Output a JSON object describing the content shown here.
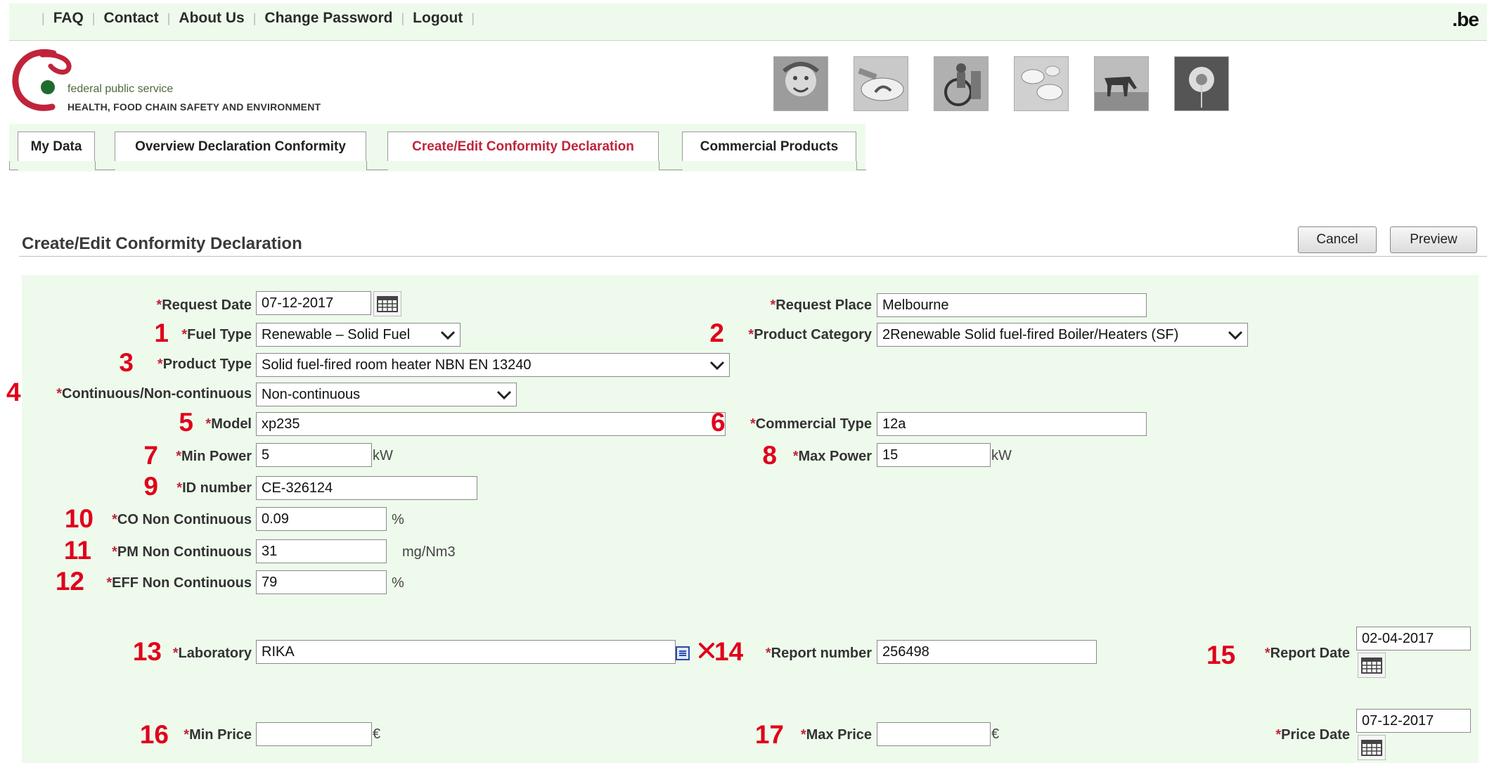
{
  "topnav": {
    "items": [
      "FAQ",
      "Contact",
      "About Us",
      "Change Password",
      "Logout"
    ],
    "brand": ".be"
  },
  "header": {
    "org_small": "federal public service",
    "org_big": "HEALTH, FOOD CHAIN SAFETY AND ENVIRONMENT",
    "photos": [
      "child-photo",
      "food-photo",
      "wheelchair-photo",
      "pills-photo",
      "horse-photo",
      "dandelion-photo"
    ]
  },
  "tabs": [
    {
      "label": "My Data",
      "active": false
    },
    {
      "label": "Overview Declaration Conformity",
      "active": false
    },
    {
      "label": "Create/Edit  Conformity Declaration",
      "active": true
    },
    {
      "label": "Commercial Products",
      "active": false
    }
  ],
  "page": {
    "title": "Create/Edit Conformity Declaration",
    "cancel_label": "Cancel",
    "preview_label": "Preview"
  },
  "form": {
    "request_date": {
      "label": "Request Date",
      "value": "07-12-2017"
    },
    "request_place": {
      "label": "Request Place",
      "value": "Melbourne"
    },
    "fuel_type": {
      "num": "1",
      "label": "Fuel Type",
      "value": "Renewable – Solid Fuel"
    },
    "product_category": {
      "num": "2",
      "label": "Product Category",
      "value": "2Renewable Solid fuel-fired Boiler/Heaters (SF)"
    },
    "product_type": {
      "num": "3",
      "label": "Product Type",
      "value": "Solid fuel-fired room heater NBN EN 13240"
    },
    "continuous": {
      "num": "4",
      "label": "Continuous/Non-continuous",
      "value": "Non-continuous"
    },
    "model": {
      "num": "5",
      "label": "Model",
      "value": "xp235"
    },
    "commercial_type": {
      "num": "6",
      "label": "Commercial Type",
      "value": "12a"
    },
    "min_power": {
      "num": "7",
      "label": "Min Power",
      "value": "5",
      "unit": "kW"
    },
    "max_power": {
      "num": "8",
      "label": "Max Power",
      "value": "15",
      "unit": "kW"
    },
    "id_number": {
      "num": "9",
      "label": "ID number",
      "value": "CE-326124"
    },
    "co": {
      "num": "10",
      "label": "CO Non Continuous",
      "value": "0.09",
      "unit": "%"
    },
    "pm": {
      "num": "11",
      "label": "PM Non Continuous",
      "value": "31",
      "unit": "mg/Nm3"
    },
    "eff": {
      "num": "12",
      "label": "EFF Non Continuous",
      "value": "79",
      "unit": "%"
    },
    "laboratory": {
      "num": "13",
      "label": "Laboratory",
      "value": "RIKA"
    },
    "report_number": {
      "num": "14",
      "label": "Report number",
      "value": "256498"
    },
    "report_date": {
      "num": "15",
      "label": "Report Date",
      "value": "02-04-2017"
    },
    "min_price": {
      "num": "16",
      "label": "Min Price",
      "value": "",
      "unit": "€"
    },
    "max_price": {
      "num": "17",
      "label": "Max Price",
      "value": "",
      "unit": "€"
    },
    "price_date": {
      "label": "Price Date",
      "value": "07-12-2017"
    }
  },
  "colors": {
    "panel": "#eefbec",
    "required": "#c0243b",
    "annotation": "#e0001b",
    "active_tab": "#c0243b"
  }
}
